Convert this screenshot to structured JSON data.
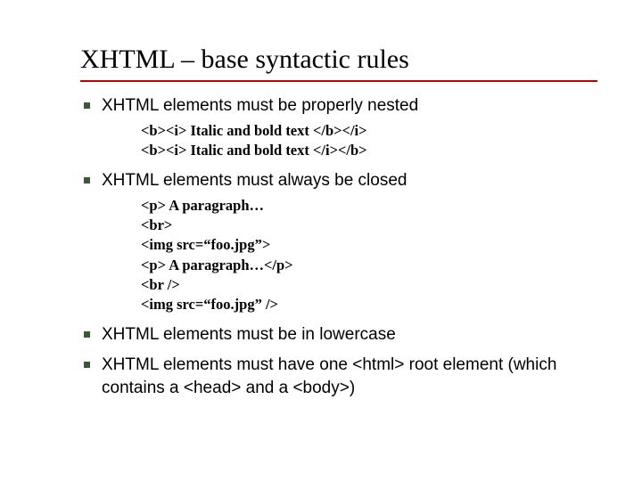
{
  "title": "XHTML – base syntactic rules",
  "bullets": [
    {
      "text": "XHTML elements must be properly nested",
      "sub": [
        "<b><i> Italic and bold text </b></i>",
        "<b><i> Italic and bold text </i></b>"
      ]
    },
    {
      "text": "XHTML elements must always be closed",
      "sub": [
        "<p> A paragraph…",
        "<br>",
        "<img src=“foo.jpg”>",
        "<p> A paragraph…</p>",
        "<br />",
        "<img src=“foo.jpg” />"
      ]
    },
    {
      "text": "XHTML elements must be in lowercase",
      "sub": []
    },
    {
      "text": "XHTML elements must have one <html> root element (which contains a <head> and a <body>)",
      "sub": []
    }
  ]
}
